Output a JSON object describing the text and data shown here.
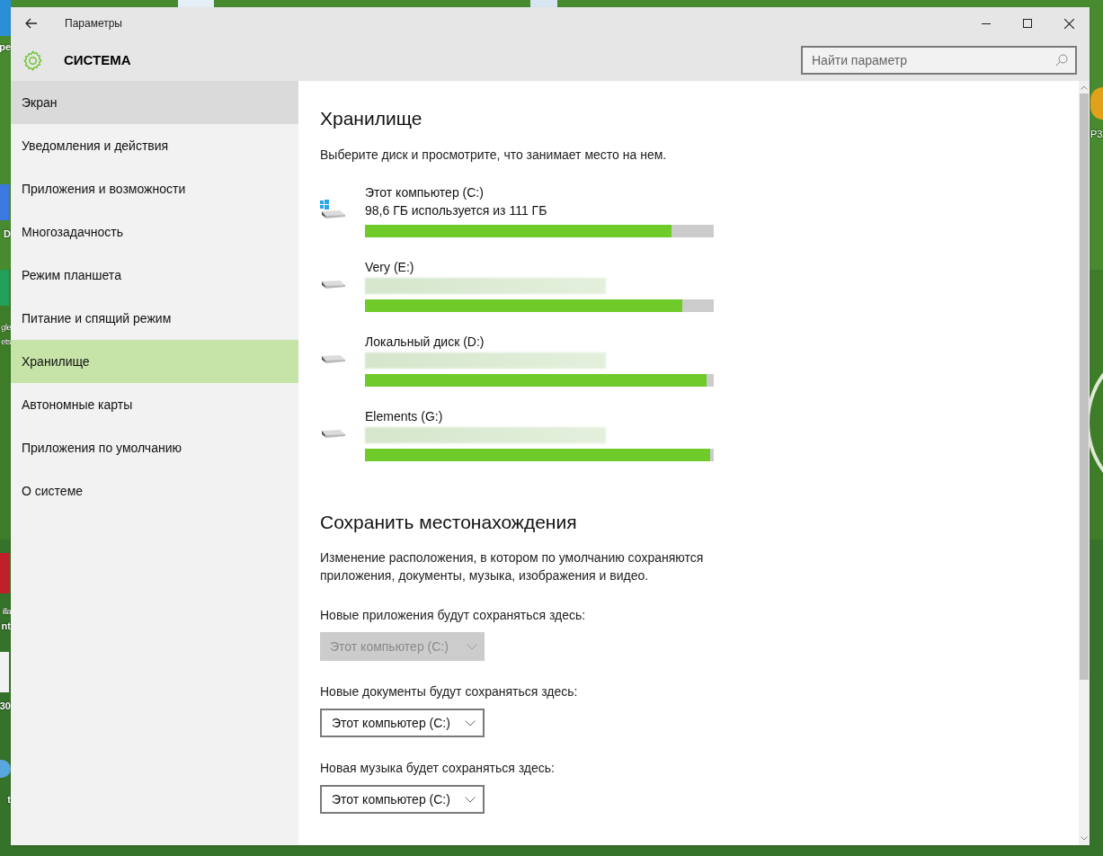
{
  "desktop": {
    "left_labels": [
      "pe",
      "D",
      "gle",
      "ets",
      "illa",
      "nt",
      "30",
      "t"
    ],
    "right_labels": [
      "P3"
    ]
  },
  "window": {
    "title": "Параметры"
  },
  "header": {
    "title": "СИСТЕМА",
    "search": {
      "placeholder": "Найти параметр"
    }
  },
  "sidebar": {
    "items": [
      {
        "label": "Экран",
        "selected": false,
        "hovered": true
      },
      {
        "label": "Уведомления и действия",
        "selected": false,
        "hovered": false
      },
      {
        "label": "Приложения и возможности",
        "selected": false,
        "hovered": false
      },
      {
        "label": "Многозадачность",
        "selected": false,
        "hovered": false
      },
      {
        "label": "Режим планшета",
        "selected": false,
        "hovered": false
      },
      {
        "label": "Питание и спящий режим",
        "selected": false,
        "hovered": false
      },
      {
        "label": "Хранилище",
        "selected": true,
        "hovered": false
      },
      {
        "label": "Автономные карты",
        "selected": false,
        "hovered": false
      },
      {
        "label": "Приложения по умолчанию",
        "selected": false,
        "hovered": false
      },
      {
        "label": "О системе",
        "selected": false,
        "hovered": false
      }
    ]
  },
  "storage": {
    "title": "Хранилище",
    "description": "Выберите диск и просмотрите, что занимает место на нем.",
    "drives": [
      {
        "kind": "system",
        "name": "Этот компьютер (C:)",
        "usage": "98,6 ГБ используется из 111 ГБ",
        "level": 0.88
      },
      {
        "kind": "local",
        "name": "Very (E:)",
        "level": 0.91
      },
      {
        "kind": "local",
        "name": "Локальный диск (D:)",
        "level": 0.98
      },
      {
        "kind": "local",
        "name": "Elements (G:)",
        "level": 0.99
      }
    ]
  },
  "save_locations": {
    "title": "Сохранить местонахождения",
    "description": "Изменение расположения, в котором по умолчанию сохраняются приложения, документы, музыка, изображения и видео.",
    "settings": [
      {
        "label": "Новые приложения будут сохраняться здесь:",
        "value": "Этот компьютер (C:)",
        "disabled": true
      },
      {
        "label": "Новые документы будут сохраняться здесь:",
        "value": "Этот компьютер (C:)",
        "disabled": false
      },
      {
        "label": "Новая музыка будет сохраняться здесь:",
        "value": "Этот компьютер (C:)",
        "disabled": false
      }
    ]
  }
}
